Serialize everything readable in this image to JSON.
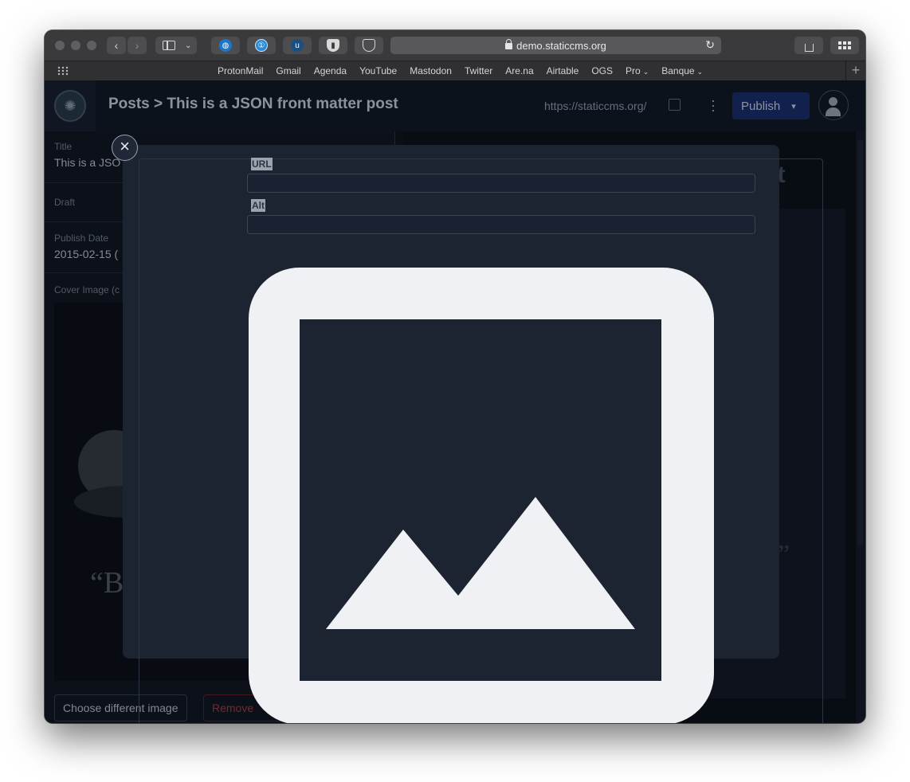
{
  "browser": {
    "url": "demo.staticcms.org",
    "bookmarks": [
      "ProtonMail",
      "Gmail",
      "Agenda",
      "YouTube",
      "Mastodon",
      "Twitter",
      "Are.na",
      "Airtable",
      "OGS"
    ],
    "bookmark_folders": [
      "Pro",
      "Banque"
    ],
    "new_tab_label": "+"
  },
  "header": {
    "breadcrumb": "Posts > This is a JSON front matter post",
    "site_link": "https://staticcms.org/",
    "publish_label": "Publish"
  },
  "editor": {
    "title_label": "Title",
    "title_value": "This is a JSO",
    "draft_label": "Draft",
    "publish_date_label": "Publish Date",
    "publish_date_value": "2015-02-15 (",
    "cover_label": "Cover Image (c",
    "cover_quote": "“Be",
    "choose_label": "Choose different image",
    "remove_label": "Remove"
  },
  "preview": {
    "title_fragment": "st",
    "quote_fragment": "”"
  },
  "modal": {
    "close_glyph": "×",
    "url_label": "URL",
    "url_value": "",
    "alt_label": "Alt",
    "alt_value": ""
  },
  "colors": {
    "app_bg": "#0f131b",
    "header_bg": "#121925",
    "modal_bg": "#1c2331",
    "publish_btn": "#1b2e70",
    "placeholder_icon": "#f0f1f5",
    "remove_text": "#b73b3b"
  }
}
